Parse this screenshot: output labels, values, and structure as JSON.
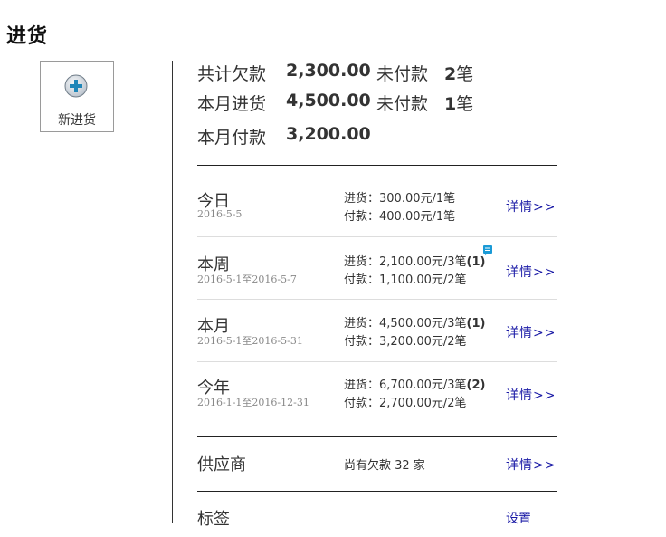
{
  "page_title": "进货",
  "new_purchase": {
    "label": "新进货",
    "icon": "plus-circle-icon"
  },
  "summary": [
    {
      "label": "共计欠款",
      "amount": "2,300.00",
      "unpaid_label": "未付款",
      "unpaid_count": "2",
      "unit": "笔"
    },
    {
      "label": "本月进货",
      "amount": "4,500.00",
      "unpaid_label": "未付款",
      "unpaid_count": "1",
      "unit": "笔"
    },
    {
      "label": "本月付款",
      "amount": "3,200.00"
    }
  ],
  "periods": [
    {
      "name": "今日",
      "date": "2016-5-5",
      "purchase": "进货：300.00元/1笔",
      "purchase_badge": "",
      "payment": "付款：400.00元/1笔",
      "detail": "详情>>"
    },
    {
      "name": "本周",
      "date": "2016-5-1至2016-5-7",
      "purchase": "进货：2,100.00元/3笔",
      "purchase_badge": "(1)",
      "payment": "付款：1,100.00元/2笔",
      "detail": "详情>>",
      "has_note_icon": true
    },
    {
      "name": "本月",
      "date": "2016-5-1至2016-5-31",
      "purchase": "进货：4,500.00元/3笔",
      "purchase_badge": "(1)",
      "payment": "付款：3,200.00元/2笔",
      "detail": "详情>>"
    },
    {
      "name": "今年",
      "date": "2016-1-1至2016-12-31",
      "purchase": "进货：6,700.00元/3笔",
      "purchase_badge": "(2)",
      "payment": "付款：2,700.00元/2笔",
      "detail": "详情>>"
    }
  ],
  "supplier": {
    "name": "供应商",
    "info": "尚有欠款 32 家",
    "detail": "详情>>"
  },
  "tags": {
    "name": "标签",
    "action": "设置"
  },
  "colors": {
    "link": "#1a1aa6",
    "note_icon": "#1a9ad6"
  }
}
